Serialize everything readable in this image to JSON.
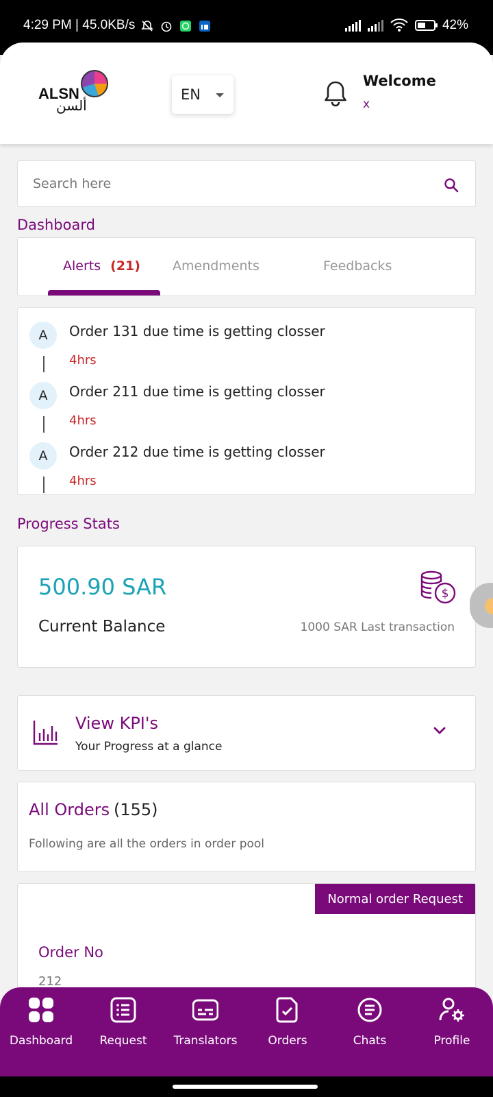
{
  "status_bar": {
    "time": "4:29 PM | 45.0KB/s",
    "battery": "42%"
  },
  "header": {
    "logo_text_latin": "ALSN",
    "logo_text_arabic": "ألسن",
    "language": "EN",
    "welcome": "Welcome",
    "username": "x"
  },
  "search": {
    "placeholder": "Search here"
  },
  "dashboard": {
    "title": "Dashboard",
    "tabs": [
      {
        "label": "Alerts",
        "count": "(21)"
      },
      {
        "label": "Amendments"
      },
      {
        "label": "Feedbacks"
      }
    ],
    "alerts": [
      {
        "avatar": "A",
        "message": "Order 131 due time is getting closser",
        "time": "4hrs"
      },
      {
        "avatar": "A",
        "message": "Order 211 due time is getting closser",
        "time": "4hrs"
      },
      {
        "avatar": "A",
        "message": "Order 212 due time is getting closser",
        "time": "4hrs"
      }
    ]
  },
  "progress": {
    "title": "Progress Stats",
    "balance_amount": "500.90 SAR",
    "balance_label": "Current Balance",
    "last_transaction": "1000 SAR Last transaction"
  },
  "kpi": {
    "title": "View KPI's",
    "subtitle": "Your Progress at a glance"
  },
  "all_orders": {
    "title": "All Orders",
    "count": "(155)",
    "description": "Following are all the orders in order pool"
  },
  "order_card": {
    "tag": "Normal order Request",
    "label": "Order No",
    "value": "212"
  },
  "bottom_nav": [
    {
      "label": "Dashboard",
      "icon": "grid-icon"
    },
    {
      "label": "Request",
      "icon": "list-icon"
    },
    {
      "label": "Translators",
      "icon": "subtitles-icon"
    },
    {
      "label": "Orders",
      "icon": "document-check-icon"
    },
    {
      "label": "Chats",
      "icon": "chat-icon"
    },
    {
      "label": "Profile",
      "icon": "user-settings-icon"
    }
  ],
  "colors": {
    "brand": "#7a0a7a",
    "accent": "#1aa3b5",
    "alert": "#c62828"
  }
}
